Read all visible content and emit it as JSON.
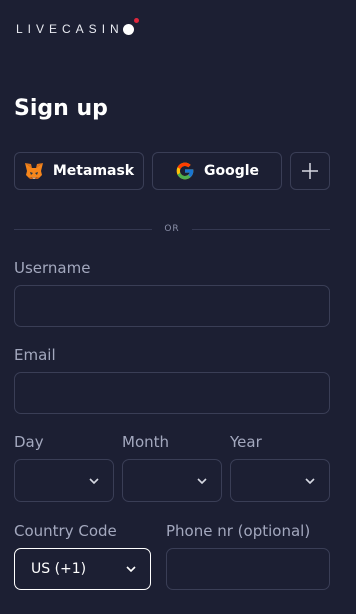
{
  "brand": {
    "logo_text": "LIVECASIN",
    "accent": "#e0263c"
  },
  "page": {
    "title": "Sign up"
  },
  "social": {
    "metamask_label": "Metamask",
    "google_label": "Google",
    "more_icon": "plus-icon"
  },
  "divider": {
    "text": "OR"
  },
  "form": {
    "username": {
      "label": "Username",
      "value": ""
    },
    "email": {
      "label": "Email",
      "value": ""
    },
    "day": {
      "label": "Day",
      "value": ""
    },
    "month": {
      "label": "Month",
      "value": ""
    },
    "year": {
      "label": "Year",
      "value": ""
    },
    "country_code": {
      "label": "Country Code",
      "value": "US (+1)"
    },
    "phone": {
      "label": "Phone nr (optional)",
      "value": ""
    }
  },
  "colors": {
    "background": "#1c1f33",
    "border": "#3a3e56",
    "label": "#a3a8be"
  }
}
